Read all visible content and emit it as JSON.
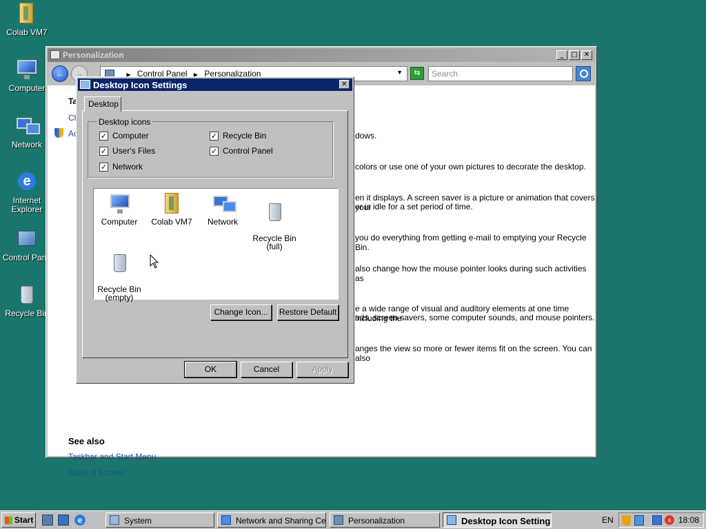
{
  "desktop": {
    "icons": [
      {
        "label": "Colab VM7",
        "icon": "folder-icon"
      },
      {
        "label": "Computer",
        "icon": "computer-icon"
      },
      {
        "label": "Network",
        "icon": "network-icon"
      },
      {
        "label": "Internet Explorer",
        "icon": "internet-explorer-icon"
      },
      {
        "label": "Control Pane",
        "icon": "control-panel-icon"
      },
      {
        "label": "Recycle Bin",
        "icon": "recycle-bin-icon"
      }
    ]
  },
  "main_window": {
    "title": "Personalization",
    "controls": {
      "minimize": "_",
      "maximize": "□",
      "close": "✕"
    },
    "address": {
      "segments": [
        "Control Panel",
        "Personalization"
      ]
    },
    "search_placeholder": "Search",
    "partial_left": [
      "Ta",
      "Ch",
      "Ad"
    ],
    "body_fragments": [
      "dows.",
      "colors or use one of your own pictures to decorate the desktop.",
      "en it displays. A screen saver is a picture or animation that covers your",
      "er is idle for a set period of time.",
      "you do everything from getting e-mail to emptying your Recycle Bin.",
      "also change how the mouse pointer looks during such activities as",
      "e a wide range of visual and auditory elements at one time including the",
      "nds, screen savers, some computer sounds, and mouse pointers.",
      "anges the view so more or fewer items fit on the screen. You can also"
    ],
    "see_also": {
      "heading": "See also",
      "links": [
        "Taskbar and Start Menu",
        "Ease of Access"
      ]
    }
  },
  "dialog": {
    "title": "Desktop Icon Settings",
    "close": "✕",
    "tab": "Desktop",
    "group_label": "Desktop icons",
    "checkboxes": [
      {
        "label": "Computer",
        "checked": true
      },
      {
        "label": "Recycle Bin",
        "checked": true
      },
      {
        "label": "User's Files",
        "checked": true
      },
      {
        "label": "Control Panel",
        "checked": true
      },
      {
        "label": "Network",
        "checked": true
      }
    ],
    "check_glyph": "✓",
    "icon_list": [
      {
        "label": "Computer",
        "icon": "computer-icon"
      },
      {
        "label": "Colab VM7",
        "icon": "folder-icon"
      },
      {
        "label": "Network",
        "icon": "network-icon"
      },
      {
        "label": "Recycle Bin\n(full)",
        "icon": "recycle-bin-full-icon"
      },
      {
        "label": "Recycle Bin\n(empty)",
        "icon": "recycle-bin-empty-icon"
      }
    ],
    "buttons": {
      "change_icon": "Change Icon...",
      "restore_default": "Restore Default",
      "ok": "OK",
      "cancel": "Cancel",
      "apply": "Apply"
    }
  },
  "taskbar": {
    "start": "Start",
    "buttons": [
      {
        "label": "System",
        "active": false
      },
      {
        "label": "Network and Sharing Cen...",
        "active": false
      },
      {
        "label": "Personalization",
        "active": false
      },
      {
        "label": "Desktop Icon Settings",
        "active": true
      }
    ],
    "language": "EN",
    "clock": "18:08"
  },
  "colors": {
    "desktop": "#1a766d",
    "dialog_title": "#0a246a",
    "link": "#1c4d9c"
  }
}
